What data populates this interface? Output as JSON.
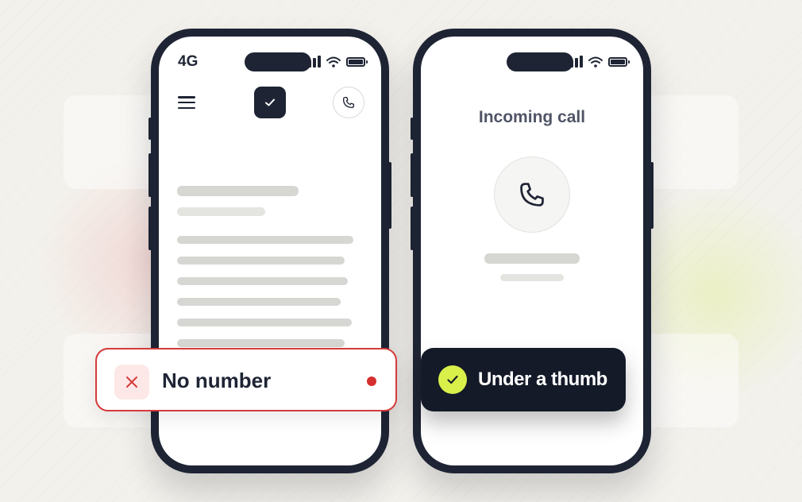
{
  "left_phone": {
    "carrier": "4G",
    "icons": [
      "signal-icon",
      "wifi-icon",
      "battery-icon",
      "menu-icon",
      "checkmark-icon",
      "phone-icon"
    ]
  },
  "right_phone": {
    "call_title": "Incoming call",
    "icons": [
      "signal-icon",
      "wifi-icon",
      "battery-icon",
      "phone-icon"
    ]
  },
  "error_toast": {
    "label": "No number",
    "icon": "close-icon",
    "accent_color": "#d53a3a"
  },
  "success_toast": {
    "label": "Under a thumb",
    "icon": "checkmark-icon",
    "accent_color": "#d9f04a"
  },
  "colors": {
    "phone_frame": "#1e2434",
    "skeleton": "#d6d6d3"
  }
}
